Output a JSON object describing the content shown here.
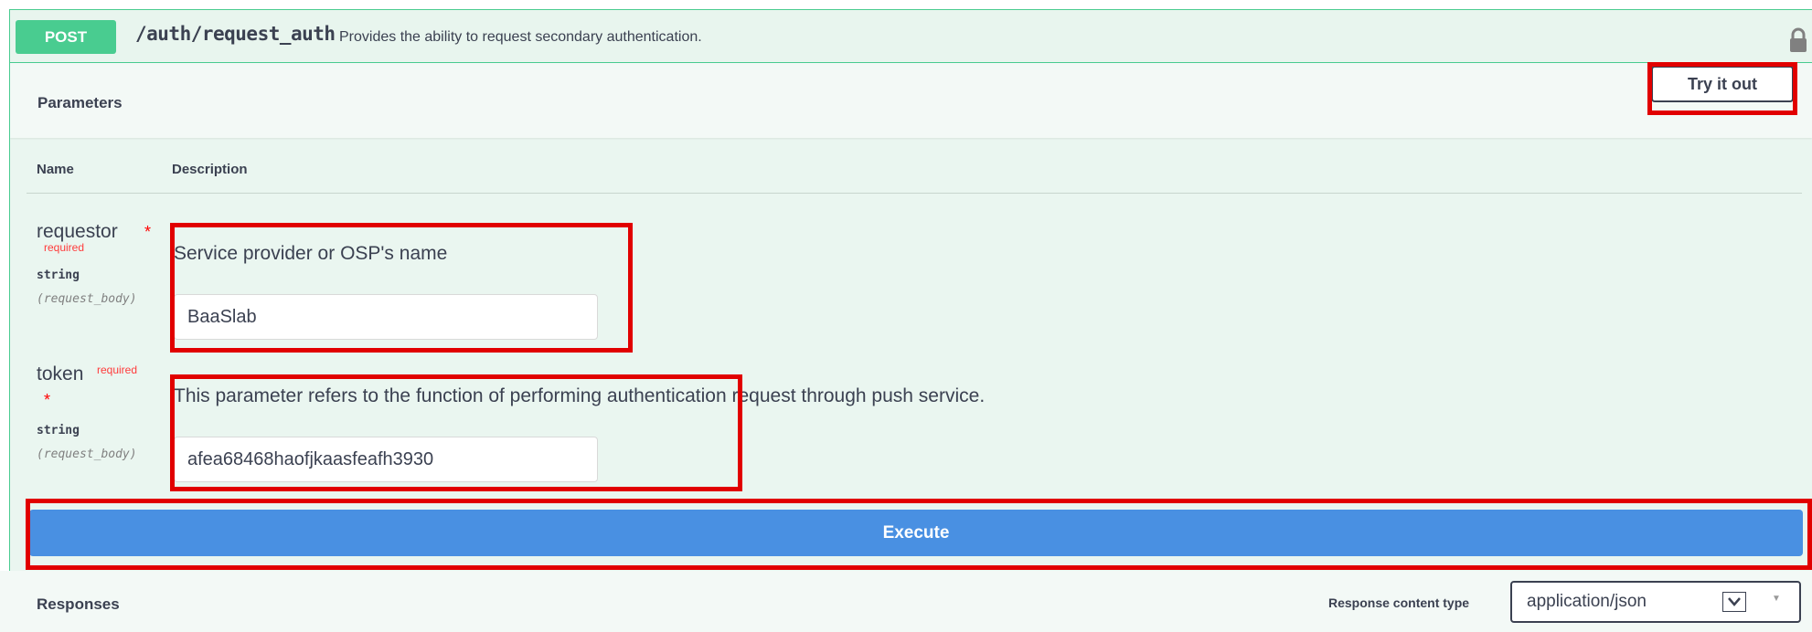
{
  "operation": {
    "method": "POST",
    "path": "/auth/request_auth",
    "summary": "Provides the ability to request secondary authentication."
  },
  "parameters_section": {
    "title": "Parameters",
    "try_it_out_label": "Try it out",
    "col_name": "Name",
    "col_description": "Description"
  },
  "params": [
    {
      "name": "requestor",
      "required_mark": "*",
      "required_label": "required",
      "type": "string",
      "in": "(request_body)",
      "description": "Service provider or OSP's name",
      "value": "BaaSlab"
    },
    {
      "name": "token",
      "required_mark": "*",
      "required_label": "required",
      "type": "string",
      "in": "(request_body)",
      "description": "This parameter refers to the function of performing authentication request through push service.",
      "value": "afea68468haofjkaasfeafh3930"
    }
  ],
  "execute_label": "Execute",
  "responses": {
    "title": "Responses",
    "content_type_label": "Response content type",
    "content_type_value": "application/json"
  },
  "colors": {
    "method_post": "#49cc90",
    "execute_button": "#4990e2",
    "highlight": "#e10000"
  },
  "icons": {
    "lock": "lock-icon",
    "select_arrow": "chevron-down-icon"
  }
}
